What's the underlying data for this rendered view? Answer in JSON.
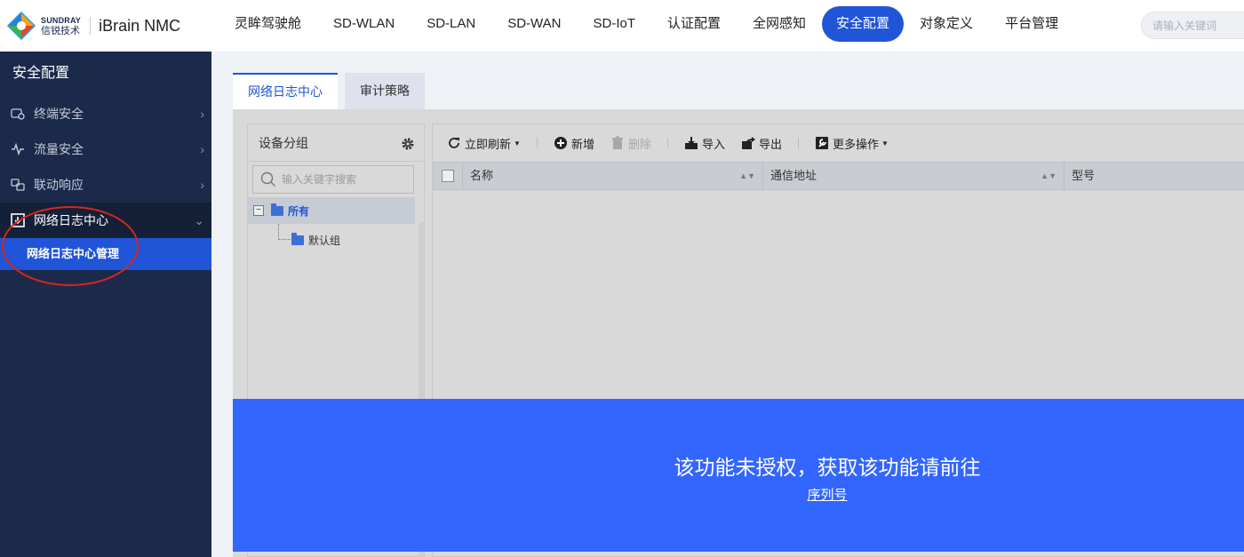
{
  "brand": {
    "logo_en": "SUNDRAY",
    "logo_cn": "信锐技术",
    "product": "iBrain NMC"
  },
  "nav": {
    "items": [
      {
        "label": "灵眸驾驶舱"
      },
      {
        "label": "SD-WLAN"
      },
      {
        "label": "SD-LAN"
      },
      {
        "label": "SD-WAN"
      },
      {
        "label": "SD-IoT"
      },
      {
        "label": "认证配置"
      },
      {
        "label": "全网感知"
      },
      {
        "label": "安全配置",
        "active": true
      },
      {
        "label": "对象定义"
      },
      {
        "label": "平台管理"
      }
    ],
    "search_placeholder": "请输入关键词"
  },
  "sidebar": {
    "title": "安全配置",
    "items": [
      {
        "label": "终端安全",
        "icon": "terminal-security-icon"
      },
      {
        "label": "流量安全",
        "icon": "traffic-pulse-icon"
      },
      {
        "label": "联动响应",
        "icon": "linkage-icon"
      },
      {
        "label": "网络日志中心",
        "icon": "log-center-icon",
        "open": true
      }
    ],
    "sub_item": "网络日志中心管理"
  },
  "tabs": [
    {
      "label": "网络日志中心",
      "active": true
    },
    {
      "label": "审计策略"
    }
  ],
  "group_panel": {
    "title": "设备分组",
    "search_placeholder": "输入关键字搜索",
    "tree_root": "所有",
    "tree_child": "默认组"
  },
  "toolbar": {
    "refresh": "立即刷新",
    "add": "新增",
    "delete": "删除",
    "import": "导入",
    "export": "导出",
    "more": "更多操作"
  },
  "table": {
    "columns": [
      "名称",
      "通信地址",
      "型号"
    ]
  },
  "overlay": {
    "message": "该功能未授权，获取该功能请前往",
    "link": "序列号"
  },
  "colors": {
    "primary": "#1f55d6",
    "sidebar_bg": "#1b2a4a",
    "overlay_bg": "#3366ff",
    "annotation": "#d9251d"
  }
}
